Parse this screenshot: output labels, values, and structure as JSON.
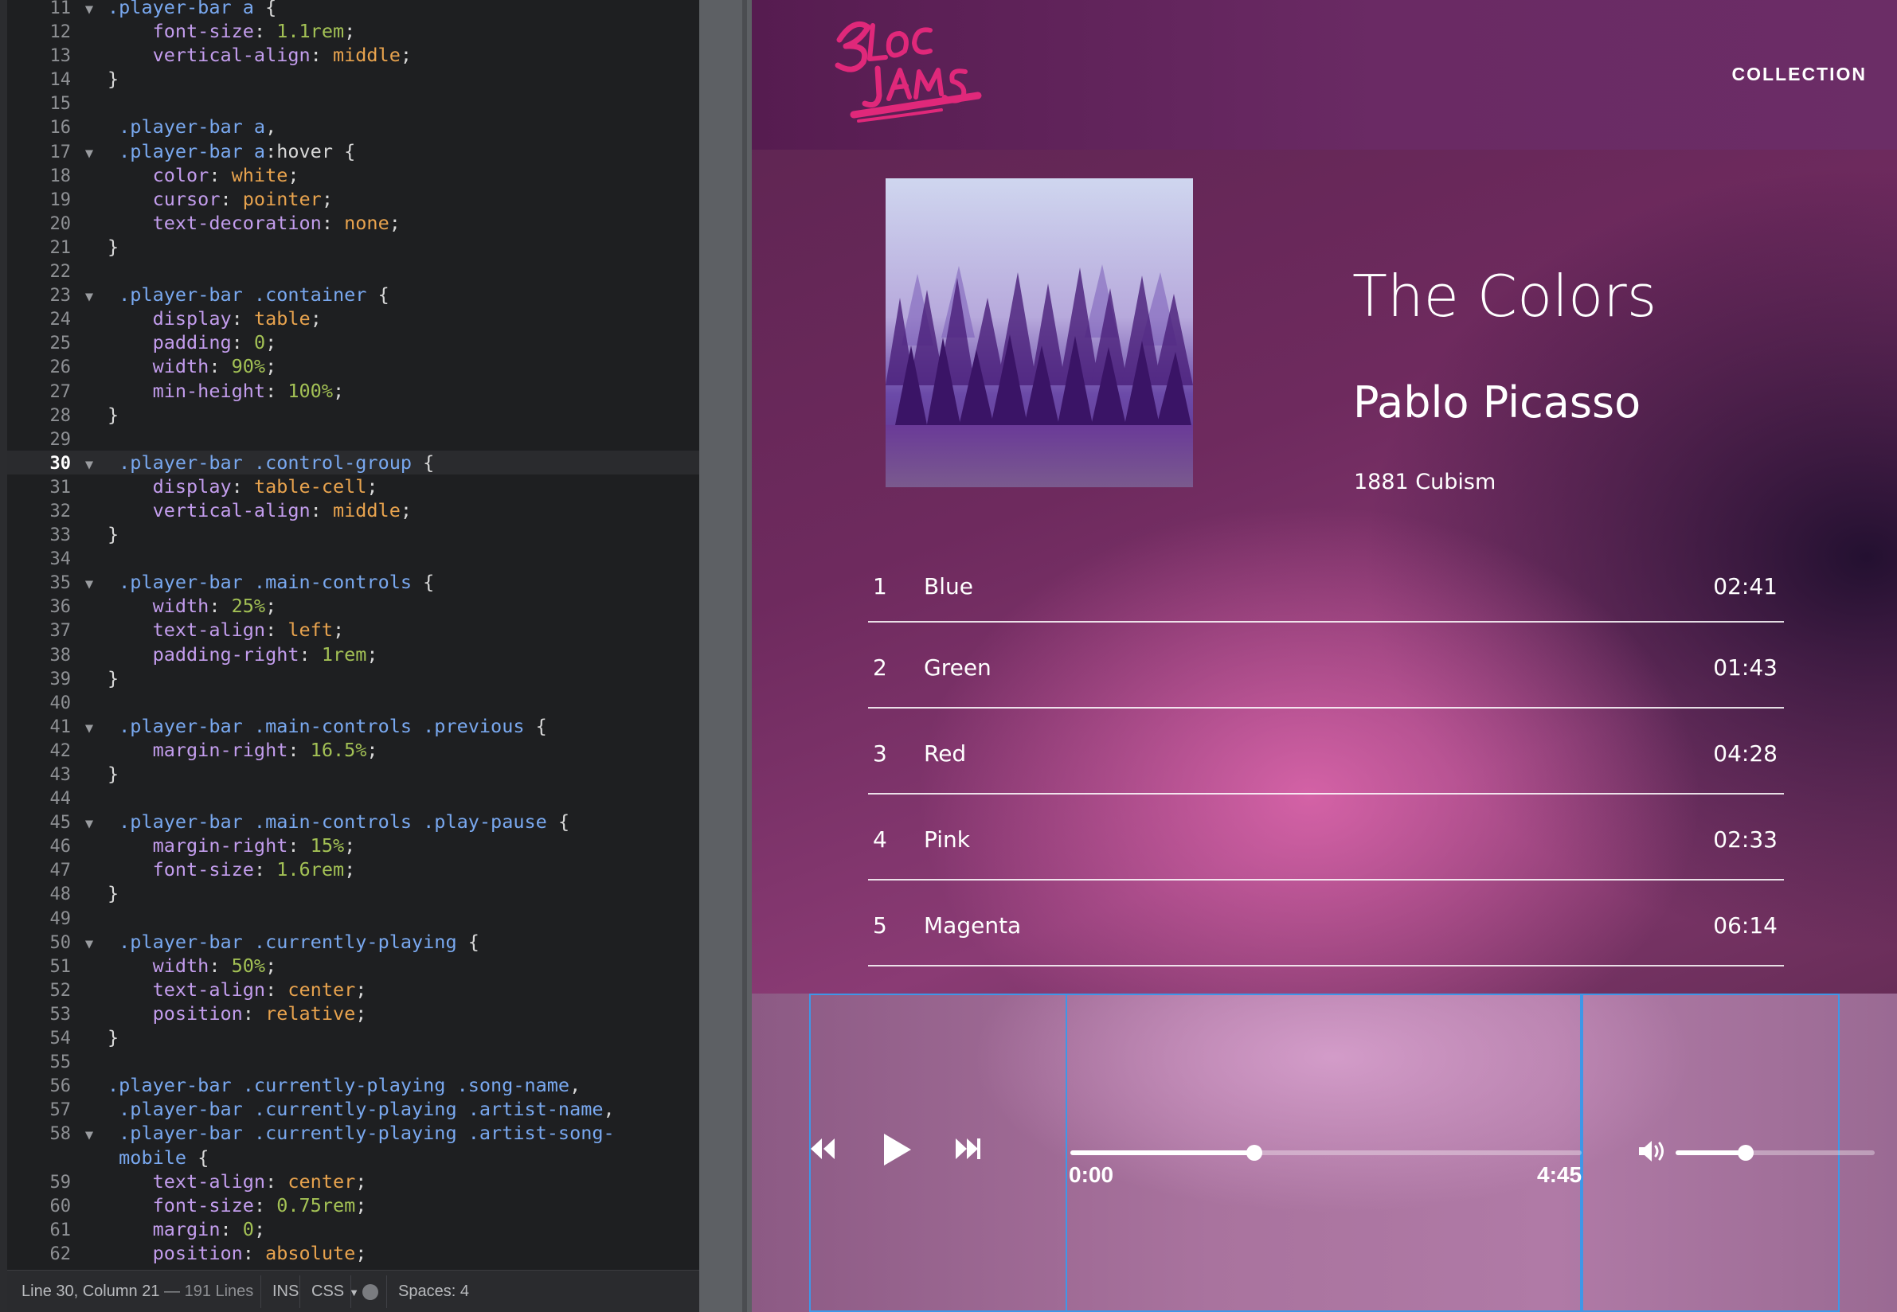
{
  "editor": {
    "lines": [
      {
        "n": "11",
        "fold": true,
        "tokens": [
          [
            "sel",
            ".player-bar a"
          ],
          [
            "punc",
            " {"
          ]
        ]
      },
      {
        "n": "12",
        "tokens": [
          [
            "punc",
            "    "
          ],
          [
            "prop",
            "font-size"
          ],
          [
            "punc",
            ": "
          ],
          [
            "num",
            "1.1rem"
          ],
          [
            "punc",
            ";"
          ]
        ]
      },
      {
        "n": "13",
        "tokens": [
          [
            "punc",
            "    "
          ],
          [
            "prop",
            "vertical-align"
          ],
          [
            "punc",
            ": "
          ],
          [
            "val",
            "middle"
          ],
          [
            "punc",
            ";"
          ]
        ]
      },
      {
        "n": "14",
        "tokens": [
          [
            "punc",
            "}"
          ]
        ]
      },
      {
        "n": "15",
        "tokens": []
      },
      {
        "n": "16",
        "tokens": [
          [
            "punc",
            " "
          ],
          [
            "sel",
            ".player-bar a"
          ],
          [
            "punc",
            ","
          ]
        ]
      },
      {
        "n": "17",
        "fold": true,
        "tokens": [
          [
            "punc",
            " "
          ],
          [
            "sel",
            ".player-bar a"
          ],
          [
            "punc",
            ":hover {"
          ]
        ]
      },
      {
        "n": "18",
        "tokens": [
          [
            "punc",
            "    "
          ],
          [
            "prop",
            "color"
          ],
          [
            "punc",
            ": "
          ],
          [
            "val",
            "white"
          ],
          [
            "punc",
            ";"
          ]
        ]
      },
      {
        "n": "19",
        "tokens": [
          [
            "punc",
            "    "
          ],
          [
            "prop",
            "cursor"
          ],
          [
            "punc",
            ": "
          ],
          [
            "val",
            "pointer"
          ],
          [
            "punc",
            ";"
          ]
        ]
      },
      {
        "n": "20",
        "tokens": [
          [
            "punc",
            "    "
          ],
          [
            "prop",
            "text-decoration"
          ],
          [
            "punc",
            ": "
          ],
          [
            "val",
            "none"
          ],
          [
            "punc",
            ";"
          ]
        ]
      },
      {
        "n": "21",
        "tokens": [
          [
            "punc",
            "}"
          ]
        ]
      },
      {
        "n": "22",
        "tokens": []
      },
      {
        "n": "23",
        "fold": true,
        "tokens": [
          [
            "punc",
            " "
          ],
          [
            "sel",
            ".player-bar .container"
          ],
          [
            "punc",
            " {"
          ]
        ]
      },
      {
        "n": "24",
        "tokens": [
          [
            "punc",
            "    "
          ],
          [
            "prop",
            "display"
          ],
          [
            "punc",
            ": "
          ],
          [
            "val",
            "table"
          ],
          [
            "punc",
            ";"
          ]
        ]
      },
      {
        "n": "25",
        "tokens": [
          [
            "punc",
            "    "
          ],
          [
            "prop",
            "padding"
          ],
          [
            "punc",
            ": "
          ],
          [
            "num",
            "0"
          ],
          [
            "punc",
            ";"
          ]
        ]
      },
      {
        "n": "26",
        "tokens": [
          [
            "punc",
            "    "
          ],
          [
            "prop",
            "width"
          ],
          [
            "punc",
            ": "
          ],
          [
            "num",
            "90%"
          ],
          [
            "punc",
            ";"
          ]
        ]
      },
      {
        "n": "27",
        "tokens": [
          [
            "punc",
            "    "
          ],
          [
            "prop",
            "min-height"
          ],
          [
            "punc",
            ": "
          ],
          [
            "num",
            "100%"
          ],
          [
            "punc",
            ";"
          ]
        ]
      },
      {
        "n": "28",
        "tokens": [
          [
            "punc",
            "}"
          ]
        ]
      },
      {
        "n": "29",
        "tokens": []
      },
      {
        "n": "30",
        "active": true,
        "fold": true,
        "tokens": [
          [
            "punc",
            " "
          ],
          [
            "sel",
            ".player-bar .control-group"
          ],
          [
            "punc",
            " {"
          ]
        ]
      },
      {
        "n": "31",
        "tokens": [
          [
            "punc",
            "    "
          ],
          [
            "prop",
            "display"
          ],
          [
            "punc",
            ": "
          ],
          [
            "val",
            "table-cell"
          ],
          [
            "punc",
            ";"
          ]
        ]
      },
      {
        "n": "32",
        "tokens": [
          [
            "punc",
            "    "
          ],
          [
            "prop",
            "vertical-align"
          ],
          [
            "punc",
            ": "
          ],
          [
            "val",
            "middle"
          ],
          [
            "punc",
            ";"
          ]
        ]
      },
      {
        "n": "33",
        "tokens": [
          [
            "punc",
            "}"
          ]
        ]
      },
      {
        "n": "34",
        "tokens": []
      },
      {
        "n": "35",
        "fold": true,
        "tokens": [
          [
            "punc",
            " "
          ],
          [
            "sel",
            ".player-bar .main-controls"
          ],
          [
            "punc",
            " {"
          ]
        ]
      },
      {
        "n": "36",
        "tokens": [
          [
            "punc",
            "    "
          ],
          [
            "prop",
            "width"
          ],
          [
            "punc",
            ": "
          ],
          [
            "num",
            "25%"
          ],
          [
            "punc",
            ";"
          ]
        ]
      },
      {
        "n": "37",
        "tokens": [
          [
            "punc",
            "    "
          ],
          [
            "prop",
            "text-align"
          ],
          [
            "punc",
            ": "
          ],
          [
            "val",
            "left"
          ],
          [
            "punc",
            ";"
          ]
        ]
      },
      {
        "n": "38",
        "tokens": [
          [
            "punc",
            "    "
          ],
          [
            "prop",
            "padding-right"
          ],
          [
            "punc",
            ": "
          ],
          [
            "num",
            "1rem"
          ],
          [
            "punc",
            ";"
          ]
        ]
      },
      {
        "n": "39",
        "tokens": [
          [
            "punc",
            "}"
          ]
        ]
      },
      {
        "n": "40",
        "tokens": []
      },
      {
        "n": "41",
        "fold": true,
        "tokens": [
          [
            "punc",
            " "
          ],
          [
            "sel",
            ".player-bar .main-controls .previous"
          ],
          [
            "punc",
            " {"
          ]
        ]
      },
      {
        "n": "42",
        "tokens": [
          [
            "punc",
            "    "
          ],
          [
            "prop",
            "margin-right"
          ],
          [
            "punc",
            ": "
          ],
          [
            "num",
            "16.5%"
          ],
          [
            "punc",
            ";"
          ]
        ]
      },
      {
        "n": "43",
        "tokens": [
          [
            "punc",
            "}"
          ]
        ]
      },
      {
        "n": "44",
        "tokens": []
      },
      {
        "n": "45",
        "fold": true,
        "tokens": [
          [
            "punc",
            " "
          ],
          [
            "sel",
            ".player-bar .main-controls .play-pause"
          ],
          [
            "punc",
            " {"
          ]
        ]
      },
      {
        "n": "46",
        "tokens": [
          [
            "punc",
            "    "
          ],
          [
            "prop",
            "margin-right"
          ],
          [
            "punc",
            ": "
          ],
          [
            "num",
            "15%"
          ],
          [
            "punc",
            ";"
          ]
        ]
      },
      {
        "n": "47",
        "tokens": [
          [
            "punc",
            "    "
          ],
          [
            "prop",
            "font-size"
          ],
          [
            "punc",
            ": "
          ],
          [
            "num",
            "1.6rem"
          ],
          [
            "punc",
            ";"
          ]
        ]
      },
      {
        "n": "48",
        "tokens": [
          [
            "punc",
            "}"
          ]
        ]
      },
      {
        "n": "49",
        "tokens": []
      },
      {
        "n": "50",
        "fold": true,
        "tokens": [
          [
            "punc",
            " "
          ],
          [
            "sel",
            ".player-bar .currently-playing"
          ],
          [
            "punc",
            " {"
          ]
        ]
      },
      {
        "n": "51",
        "tokens": [
          [
            "punc",
            "    "
          ],
          [
            "prop",
            "width"
          ],
          [
            "punc",
            ": "
          ],
          [
            "num",
            "50%"
          ],
          [
            "punc",
            ";"
          ]
        ]
      },
      {
        "n": "52",
        "tokens": [
          [
            "punc",
            "    "
          ],
          [
            "prop",
            "text-align"
          ],
          [
            "punc",
            ": "
          ],
          [
            "val",
            "center"
          ],
          [
            "punc",
            ";"
          ]
        ]
      },
      {
        "n": "53",
        "tokens": [
          [
            "punc",
            "    "
          ],
          [
            "prop",
            "position"
          ],
          [
            "punc",
            ": "
          ],
          [
            "val",
            "relative"
          ],
          [
            "punc",
            ";"
          ]
        ]
      },
      {
        "n": "54",
        "tokens": [
          [
            "punc",
            "}"
          ]
        ]
      },
      {
        "n": "55",
        "tokens": []
      },
      {
        "n": "56",
        "tokens": [
          [
            "sel",
            ".player-bar .currently-playing .song-name"
          ],
          [
            "punc",
            ","
          ]
        ]
      },
      {
        "n": "57",
        "tokens": [
          [
            "punc",
            " "
          ],
          [
            "sel",
            ".player-bar .currently-playing .artist-name"
          ],
          [
            "punc",
            ","
          ]
        ]
      },
      {
        "n": "58",
        "fold": true,
        "tokens": [
          [
            "punc",
            " "
          ],
          [
            "sel",
            ".player-bar .currently-playing .artist-song-"
          ]
        ]
      },
      {
        "n": "",
        "tokens": [
          [
            "sel",
            " mobile"
          ],
          [
            "punc",
            " {"
          ]
        ]
      },
      {
        "n": "59",
        "tokens": [
          [
            "punc",
            "    "
          ],
          [
            "prop",
            "text-align"
          ],
          [
            "punc",
            ": "
          ],
          [
            "val",
            "center"
          ],
          [
            "punc",
            ";"
          ]
        ]
      },
      {
        "n": "60",
        "tokens": [
          [
            "punc",
            "    "
          ],
          [
            "prop",
            "font-size"
          ],
          [
            "punc",
            ": "
          ],
          [
            "num",
            "0.75rem"
          ],
          [
            "punc",
            ";"
          ]
        ]
      },
      {
        "n": "61",
        "tokens": [
          [
            "punc",
            "    "
          ],
          [
            "prop",
            "margin"
          ],
          [
            "punc",
            ": "
          ],
          [
            "num",
            "0"
          ],
          [
            "punc",
            ";"
          ]
        ]
      },
      {
        "n": "62",
        "tokens": [
          [
            "punc",
            "    "
          ],
          [
            "prop",
            "position"
          ],
          [
            "punc",
            ": "
          ],
          [
            "val",
            "absolute"
          ],
          [
            "punc",
            ";"
          ]
        ]
      }
    ],
    "status": {
      "position": "Line 30, Column 21",
      "line_count": " — 191 Lines",
      "mode": "INS",
      "language": "CSS",
      "spaces": "Spaces: 4"
    },
    "colors": {
      "selector": "#79a8ef",
      "property": "#c39ded",
      "value": "#e8a34e",
      "number": "#a3c155"
    }
  },
  "preview": {
    "logo_text": "BLOC JAMS",
    "nav": {
      "collection": "COLLECTION"
    },
    "album": {
      "title": "The Colors",
      "artist": "Pablo Picasso",
      "release": "1881 Cubism"
    },
    "songs": [
      {
        "number": "1",
        "title": "Blue",
        "duration": "02:41"
      },
      {
        "number": "2",
        "title": "Green",
        "duration": "01:43"
      },
      {
        "number": "3",
        "title": "Red",
        "duration": "04:28"
      },
      {
        "number": "4",
        "title": "Pink",
        "duration": "02:33"
      },
      {
        "number": "5",
        "title": "Magenta",
        "duration": "06:14"
      }
    ],
    "player": {
      "current_time": "0:00",
      "total_time": "4:45",
      "song_progress": 0.36,
      "volume_level": 0.35,
      "previous_icon": "previous-icon",
      "play_icon": "play-icon",
      "next_icon": "next-icon",
      "volume_icon": "volume-icon"
    }
  }
}
